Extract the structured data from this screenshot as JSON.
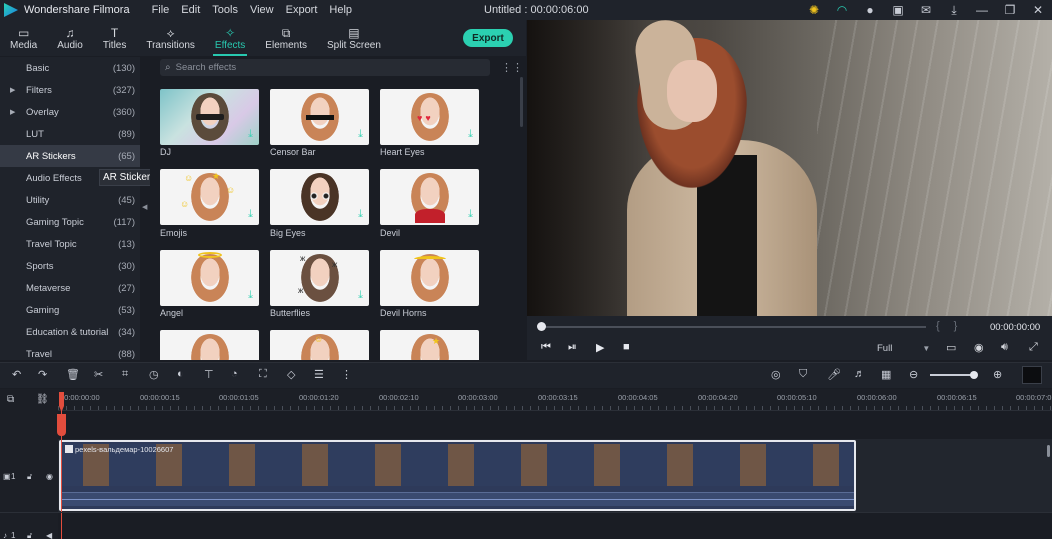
{
  "titlebar": {
    "app_name": "Wondershare Filmora",
    "menu": [
      "File",
      "Edit",
      "Tools",
      "View",
      "Export",
      "Help"
    ],
    "project_title": "Untitled : 00:00:06:00"
  },
  "toolbar": {
    "tabs": [
      {
        "label": "Media",
        "icon": "folder-icon"
      },
      {
        "label": "Audio",
        "icon": "music-note-icon"
      },
      {
        "label": "Titles",
        "icon": "text-icon"
      },
      {
        "label": "Transitions",
        "icon": "transition-icon"
      },
      {
        "label": "Effects",
        "icon": "effects-icon",
        "active": true
      },
      {
        "label": "Elements",
        "icon": "elements-icon"
      },
      {
        "label": "Split Screen",
        "icon": "split-screen-icon"
      }
    ],
    "export_label": "Export"
  },
  "categories": [
    {
      "label": "Basic",
      "count": "(130)"
    },
    {
      "label": "Filters",
      "count": "(327)",
      "expandable": true
    },
    {
      "label": "Overlay",
      "count": "(360)",
      "expandable": true
    },
    {
      "label": "LUT",
      "count": "(89)"
    },
    {
      "label": "AR Stickers",
      "count": "(65)",
      "active": true
    },
    {
      "label": "Audio Effects",
      "count": ""
    },
    {
      "label": "Utility",
      "count": "(45)"
    },
    {
      "label": "Gaming Topic",
      "count": "(117)"
    },
    {
      "label": "Travel Topic",
      "count": "(13)"
    },
    {
      "label": "Sports",
      "count": "(30)"
    },
    {
      "label": "Metaverse",
      "count": "(27)"
    },
    {
      "label": "Gaming",
      "count": "(53)"
    },
    {
      "label": "Education & tutorial",
      "count": "(34)"
    },
    {
      "label": "Travel",
      "count": "(88)"
    }
  ],
  "tooltip": "AR Stickers",
  "search": {
    "placeholder": "Search effects"
  },
  "effects": [
    {
      "label": "DJ"
    },
    {
      "label": "Censor Bar"
    },
    {
      "label": "Heart Eyes"
    },
    {
      "label": "Emojis"
    },
    {
      "label": "Big Eyes"
    },
    {
      "label": "Devil"
    },
    {
      "label": "Angel"
    },
    {
      "label": "Butterflies"
    },
    {
      "label": "Devil Horns"
    }
  ],
  "player": {
    "timecode": "00:00:00:00",
    "quality": "Full"
  },
  "timeline": {
    "ruler": [
      "00:00:00:00",
      "00:00:00:15",
      "00:00:01:05",
      "00:00:01:20",
      "00:00:02:10",
      "00:00:03:00",
      "00:00:03:15",
      "00:00:04:05",
      "00:00:04:20",
      "00:00:05:10",
      "00:00:06:00",
      "00:00:06:15",
      "00:00:07:0"
    ],
    "clip_title": "pexels-вальдемар-10026607",
    "track1_label": "1",
    "track2_label": "1"
  },
  "colors": {
    "accent": "#28c9b0",
    "playhead": "#e24d3d",
    "clip": "#2e3a5a"
  }
}
